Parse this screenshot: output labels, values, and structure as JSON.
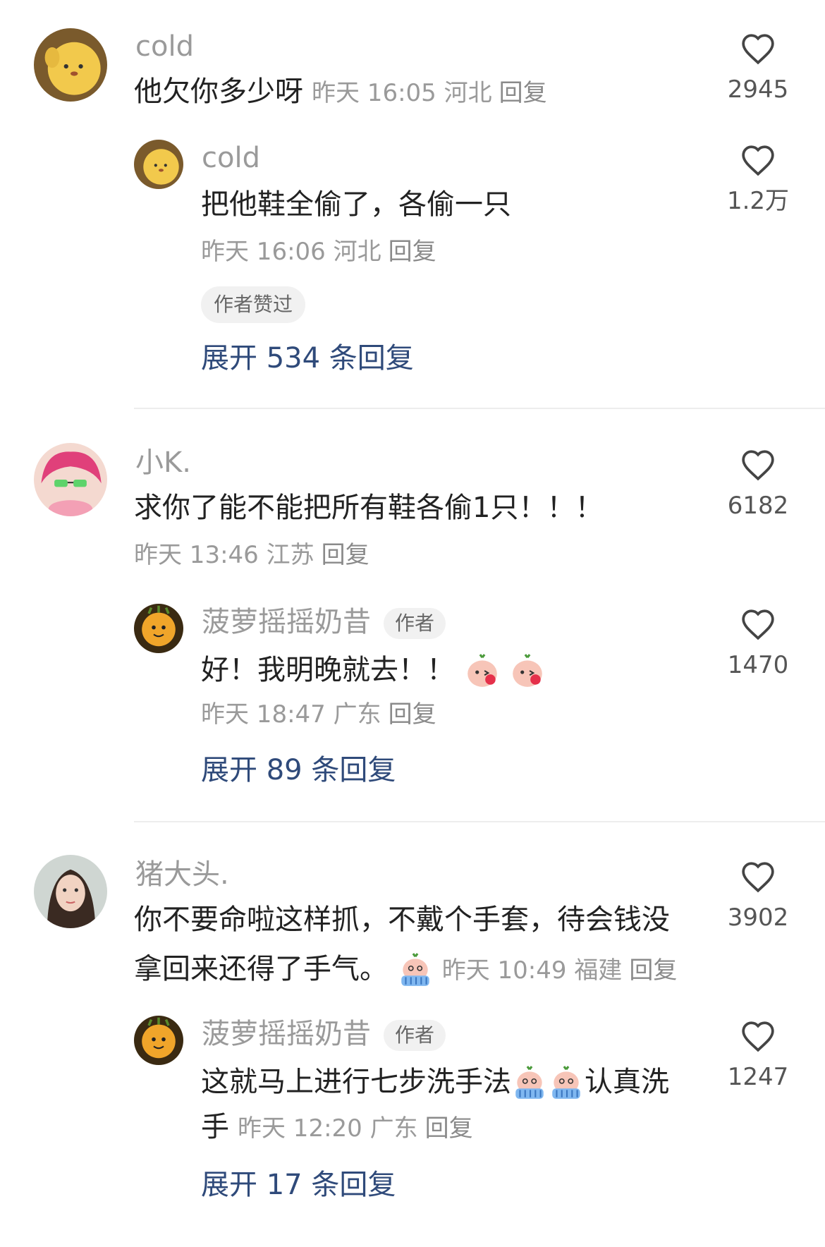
{
  "comments": [
    {
      "name": "cold",
      "text": "他欠你多少呀",
      "meta": "昨天 16:05 河北",
      "reply": "回复",
      "likes": "2945",
      "replies": [
        {
          "name": "cold",
          "text": "把他鞋全偷了，各偷一只",
          "meta": "昨天 16:06 河北",
          "reply": "回复",
          "likes": "1.2万",
          "badge": "作者赞过"
        }
      ],
      "expand": "展开 534 条回复"
    },
    {
      "name": "小K.",
      "text": "求你了能不能把所有鞋各偷1只！！！",
      "meta": "昨天 13:46 江苏",
      "reply": "回复",
      "likes": "6182",
      "replies": [
        {
          "name": "菠萝摇摇奶昔",
          "author_tag": "作者",
          "text": "好！我明晚就去！！",
          "meta": "昨天 18:47 广东",
          "reply": "回复",
          "likes": "1470"
        }
      ],
      "expand": "展开 89 条回复"
    },
    {
      "name": "猪大头.",
      "text_line1": "你不要命啦这样抓，不戴个手套，待会钱没",
      "text_line2": "拿回来还得了手气。",
      "meta": "昨天 10:49 福建",
      "reply": "回复",
      "likes": "3902",
      "replies": [
        {
          "name": "菠萝摇摇奶昔",
          "author_tag": "作者",
          "text_part1": "这就马上进行七步洗手法",
          "text_part2": "认真洗",
          "text_line2": "手",
          "meta": "昨天 12:20 广东",
          "reply": "回复",
          "likes": "1247"
        }
      ],
      "expand": "展开 17 条回复"
    }
  ],
  "colors": {
    "link": "#2f4a7a",
    "muted": "#9a9a9a",
    "text": "#222222"
  }
}
